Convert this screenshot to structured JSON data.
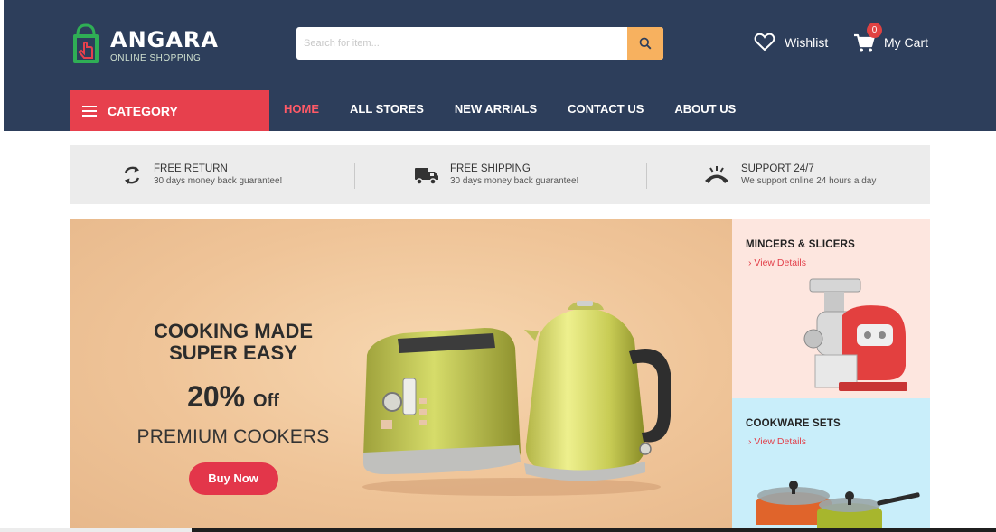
{
  "brand": {
    "name": "ANGARA",
    "tagline": "ONLINE SHOPPING",
    "colors": {
      "header": "#2d3e5b",
      "accent": "#e7404d",
      "search_button": "#f7b15f"
    }
  },
  "search": {
    "placeholder": "Search for item...",
    "icon": "search-icon"
  },
  "header": {
    "wishlist_label": "Wishlist",
    "cart_label": "My Cart",
    "cart_count": "0"
  },
  "category_button": {
    "label": "CATEGORY",
    "icon": "hamburger-icon"
  },
  "nav": {
    "items": [
      {
        "label": "HOME",
        "active": true
      },
      {
        "label": "ALL STORES"
      },
      {
        "label": "NEW ARRIALS"
      },
      {
        "label": "CONTACT US"
      },
      {
        "label": "ABOUT US"
      }
    ]
  },
  "features": [
    {
      "title": "FREE RETURN",
      "subtitle": "30 days money back guarantee!",
      "icon": "refresh-icon"
    },
    {
      "title": "FREE SHIPPING",
      "subtitle": "30 days money back guarantee!",
      "icon": "truck-icon"
    },
    {
      "title": "SUPPORT 24/7",
      "subtitle": "We support online 24 hours a day",
      "icon": "phone-icon"
    }
  ],
  "hero": {
    "headline_line1": "COOKING MADE",
    "headline_line2": "SUPER EASY",
    "discount": "20%",
    "discount_suffix": "Off",
    "subtitle": "PREMIUM COOKERS",
    "cta": "Buy Now"
  },
  "side_banners": [
    {
      "title": "MINCERS & SLICERS",
      "link": "View Details"
    },
    {
      "title": "COOKWARE SETS",
      "link": "View Details"
    }
  ]
}
